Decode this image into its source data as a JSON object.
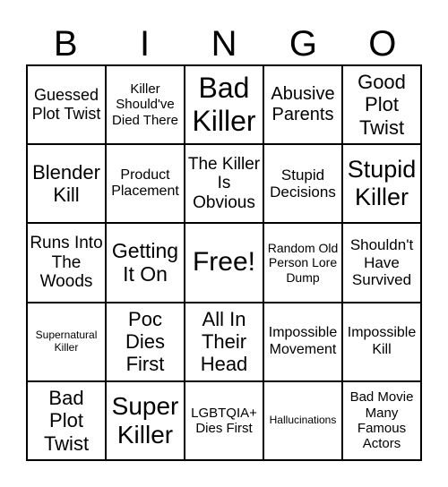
{
  "header": [
    "B",
    "I",
    "N",
    "G",
    "O"
  ],
  "cells": [
    "Guessed Plot Twist",
    "Killer Should've Died There",
    "Bad Killer",
    "Abusive Parents",
    "Good Plot Twist",
    "Blender Kill",
    "Product Placement",
    "The Killer Is Obvious",
    "Stupid Decisions",
    "Stupid Killer",
    "Runs Into The Woods",
    "Getting It On",
    "Free!",
    "Random Old Person Lore Dump",
    "Shouldn't Have Survived",
    "Supernatural Killer",
    "Poc Dies First",
    "All In Their Head",
    "Impossible Movement",
    "Impossible Kill",
    "Bad Plot Twist",
    "Super Killer",
    "LGBTQIA+ Dies First",
    "Hallucinations",
    "Bad Movie Many Famous Actors"
  ]
}
